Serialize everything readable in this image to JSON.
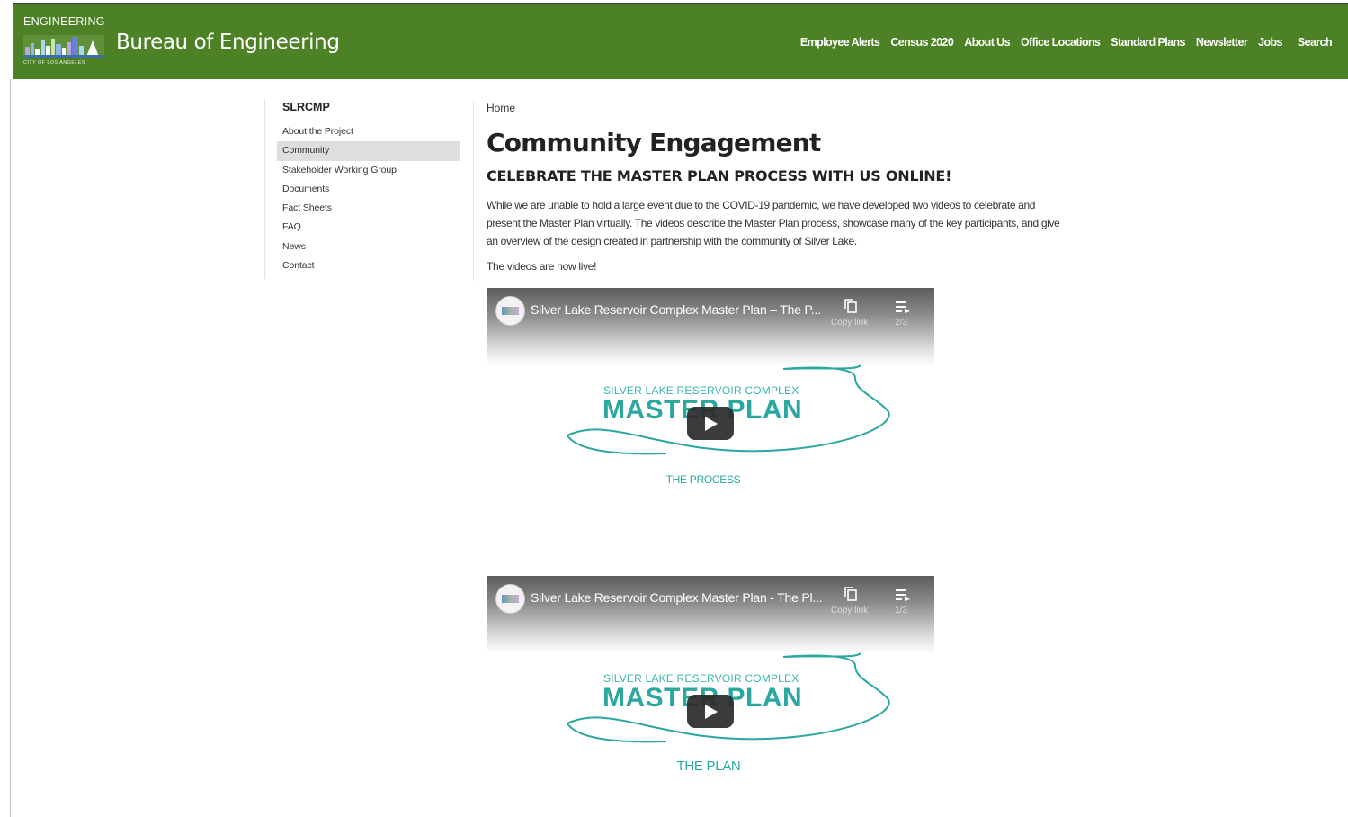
{
  "header": {
    "logo_word": "ENGINEERING",
    "logo_sub": "CITY OF LOS ANGELES",
    "title": "Bureau of Engineering",
    "nav": [
      "Employee Alerts",
      "Census 2020",
      "About Us",
      "Office Locations",
      "Standard Plans",
      "Newsletter",
      "Jobs",
      "Search"
    ],
    "bg_color": "#4c8125"
  },
  "sidebar": {
    "title": "SLRCMP",
    "items": [
      {
        "label": "About the Project",
        "active": false
      },
      {
        "label": "Community",
        "active": true
      },
      {
        "label": "Stakeholder Working Group",
        "active": false
      },
      {
        "label": "Documents",
        "active": false
      },
      {
        "label": "Fact Sheets",
        "active": false
      },
      {
        "label": "FAQ",
        "active": false
      },
      {
        "label": "News",
        "active": false
      },
      {
        "label": "Contact",
        "active": false
      }
    ]
  },
  "main": {
    "breadcrumb": "Home",
    "title": "Community Engagement",
    "subhead": "CELEBRATE THE MASTER PLAN PROCESS WITH US ONLINE!",
    "intro": "While we are unable to hold a large event due to the COVID-19 pandemic, we have developed two videos to celebrate and present the Master Plan virtually. The videos describe the Master Plan process, showcase many of the key participants, and give an overview of the design created in partnership with the community of Silver Lake.",
    "live_text": "The videos are now live!"
  },
  "videos": [
    {
      "title": "Silver Lake Reservoir Complex Master Plan – The P...",
      "copy_label": "Copy link",
      "count": "2/3",
      "thumb_small": "SILVER LAKE RESERVOIR COMPLEX",
      "thumb_big": "MASTER PLAN",
      "caption": "THE PROCESS"
    },
    {
      "title": "Silver Lake Reservoir Complex Master Plan - The Pl...",
      "copy_label": "Copy link",
      "count": "1/3",
      "thumb_small": "SILVER LAKE RESERVOIR COMPLEX",
      "thumb_big": "MASTER PLAN",
      "caption": "THE PLAN"
    }
  ],
  "colors": {
    "accent_teal": "#2aa7a0",
    "active_item": "#dedede"
  }
}
